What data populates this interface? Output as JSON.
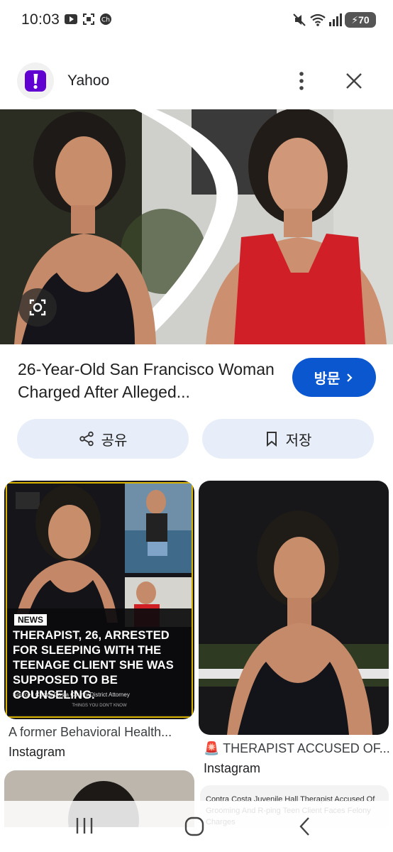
{
  "status_bar": {
    "time": "10:03",
    "battery": "70",
    "icons": [
      "youtube-icon",
      "screenshot-icon",
      "ch-badge-icon",
      "mute-icon",
      "wifi-icon",
      "signal-icon",
      "battery-icon"
    ]
  },
  "header": {
    "app_name": "Yahoo",
    "logo_glyph": "!",
    "brand_color": "#6001d2",
    "icons": [
      "more-vert-icon",
      "close-icon"
    ]
  },
  "hero": {
    "title": "26-Year-Old San Francisco Woman Charged After Alleged...",
    "visit_label": "방문",
    "share_label": "공유",
    "save_label": "저장",
    "accent_color": "#0b57d0"
  },
  "results": [
    {
      "news_tag": "NEWS",
      "headline": "THERAPIST, 26, ARRESTED FOR SLEEPING WITH THE TEENAGE CLIENT SHE WAS SUPPOSED TO BE COUNSELING.",
      "source_line": "Source | Contra Costa County District Attorney",
      "footer_line": "THINGS YOU DON'T KNOW",
      "caption": "A former Behavioral Health...",
      "source": "Instagram"
    },
    {
      "caption": "🚨 THERAPIST ACCUSED OF...",
      "source": "Instagram"
    },
    {
      "mini_text": "Contra Costa Juvenile Hall Therapist Accused Of Grooming And R-ping Teen Client Faces Felony Charges"
    }
  ]
}
